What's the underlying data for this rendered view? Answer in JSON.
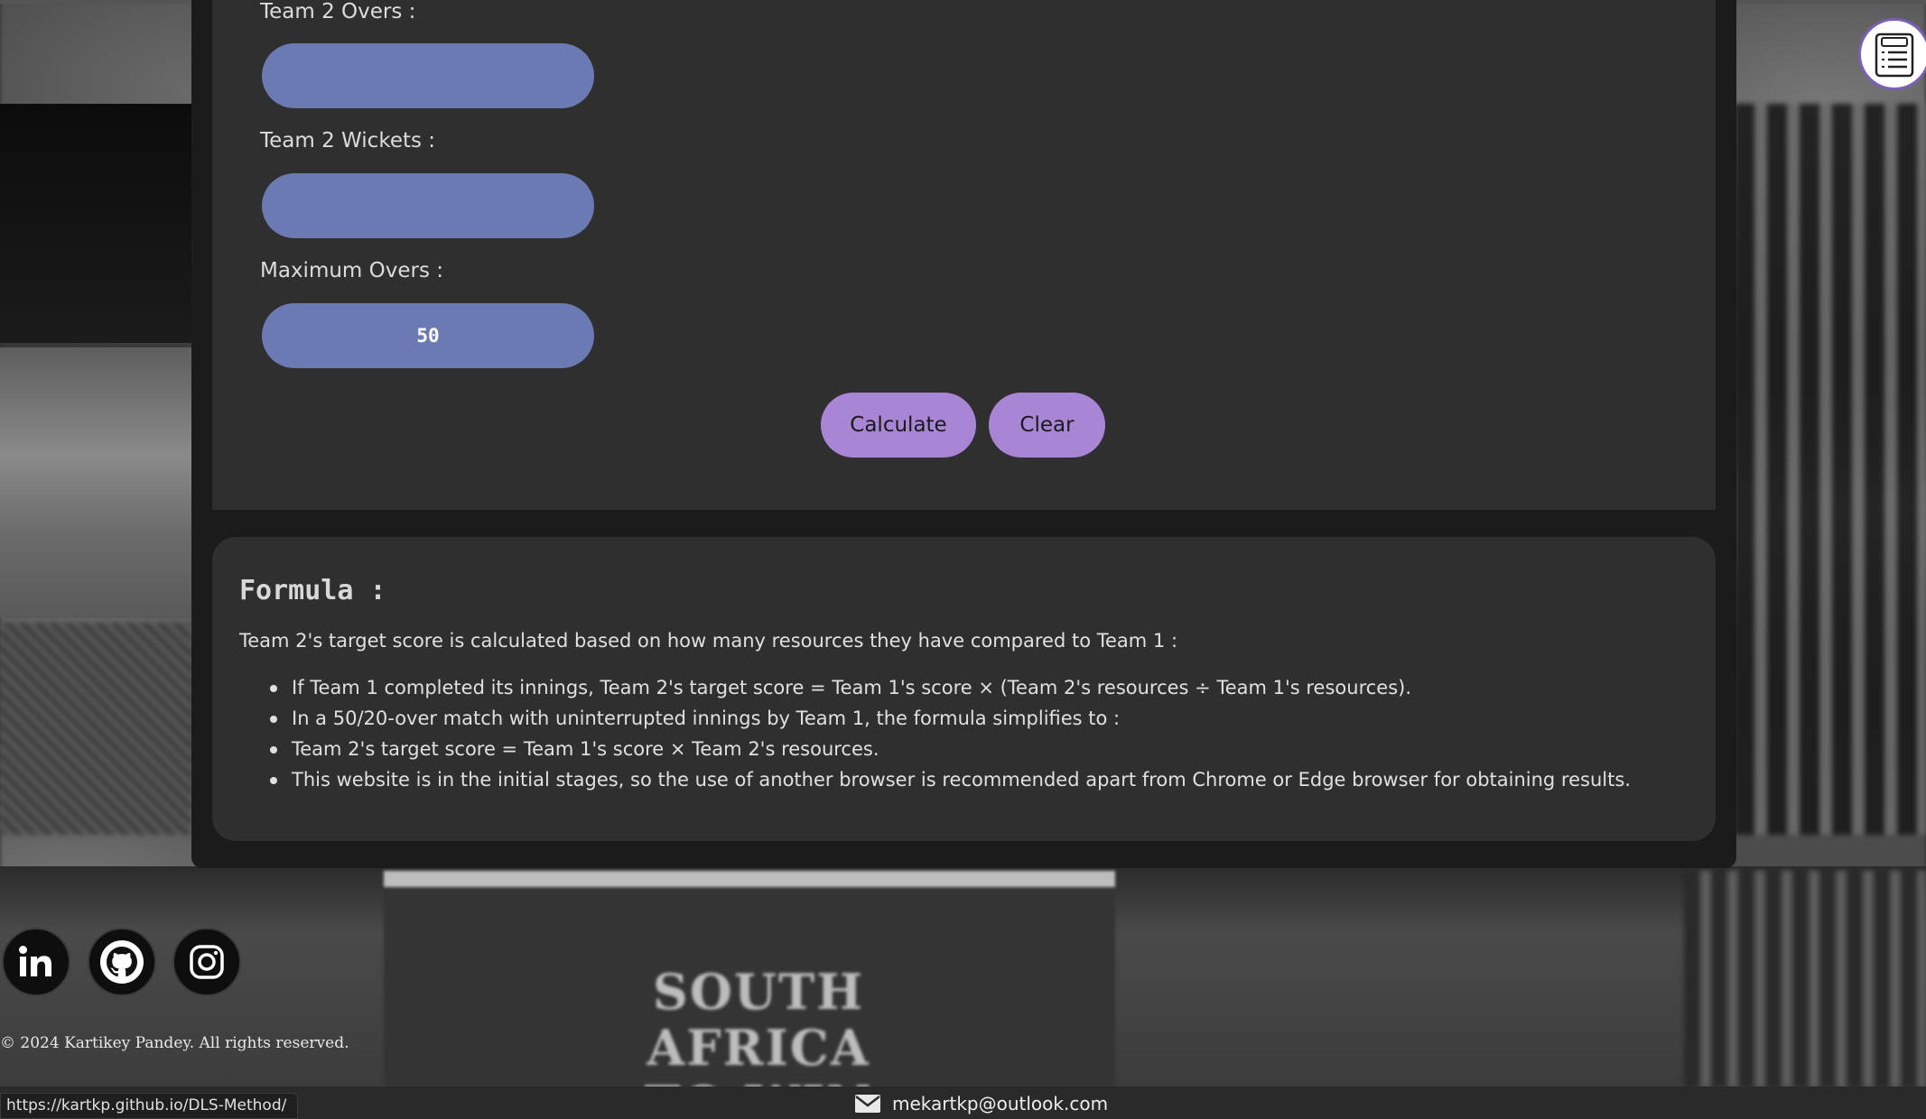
{
  "form": {
    "team2_overs_label": "Team 2 Overs :",
    "team2_overs_value": "",
    "team2_wickets_label": "Team 2 Wickets :",
    "team2_wickets_value": "",
    "max_overs_label": "Maximum Overs :",
    "max_overs_value": "50",
    "calculate_label": "Calculate",
    "clear_label": "Clear"
  },
  "formula": {
    "title": "Formula :",
    "intro": "Team 2's target score is calculated based on how many resources they have compared to Team 1 :",
    "points": [
      "If Team 1 completed its innings, Team 2's target score = Team 1's score × (Team 2's resources ÷ Team 1's resources).",
      "In a 50/20-over match with uninterrupted innings by Team 1, the formula simplifies to :",
      "Team 2's target score = Team 1's score × Team 2's resources.",
      "This website is in the initial stages, so the use of another browser is recommended apart from Chrome or Edge browser for obtaining results."
    ]
  },
  "background": {
    "scoreboard_text_line1": "SOUTH AFRICA",
    "scoreboard_text_line2": "TO WIN"
  },
  "footer": {
    "socials": [
      "linkedin-icon",
      "github-icon",
      "instagram-icon"
    ],
    "copyright": "© 2024 Kartikey Pandey. All rights reserved.",
    "status_url": "https://kartkp.github.io/DLS-Method/",
    "email": "mekartkp@outlook.com"
  },
  "colors": {
    "input_bg": "#6c7ab4",
    "button_bg": "#a985d6",
    "panel_bg": "#2f2f2f",
    "card_bg": "#1b1b1b"
  }
}
